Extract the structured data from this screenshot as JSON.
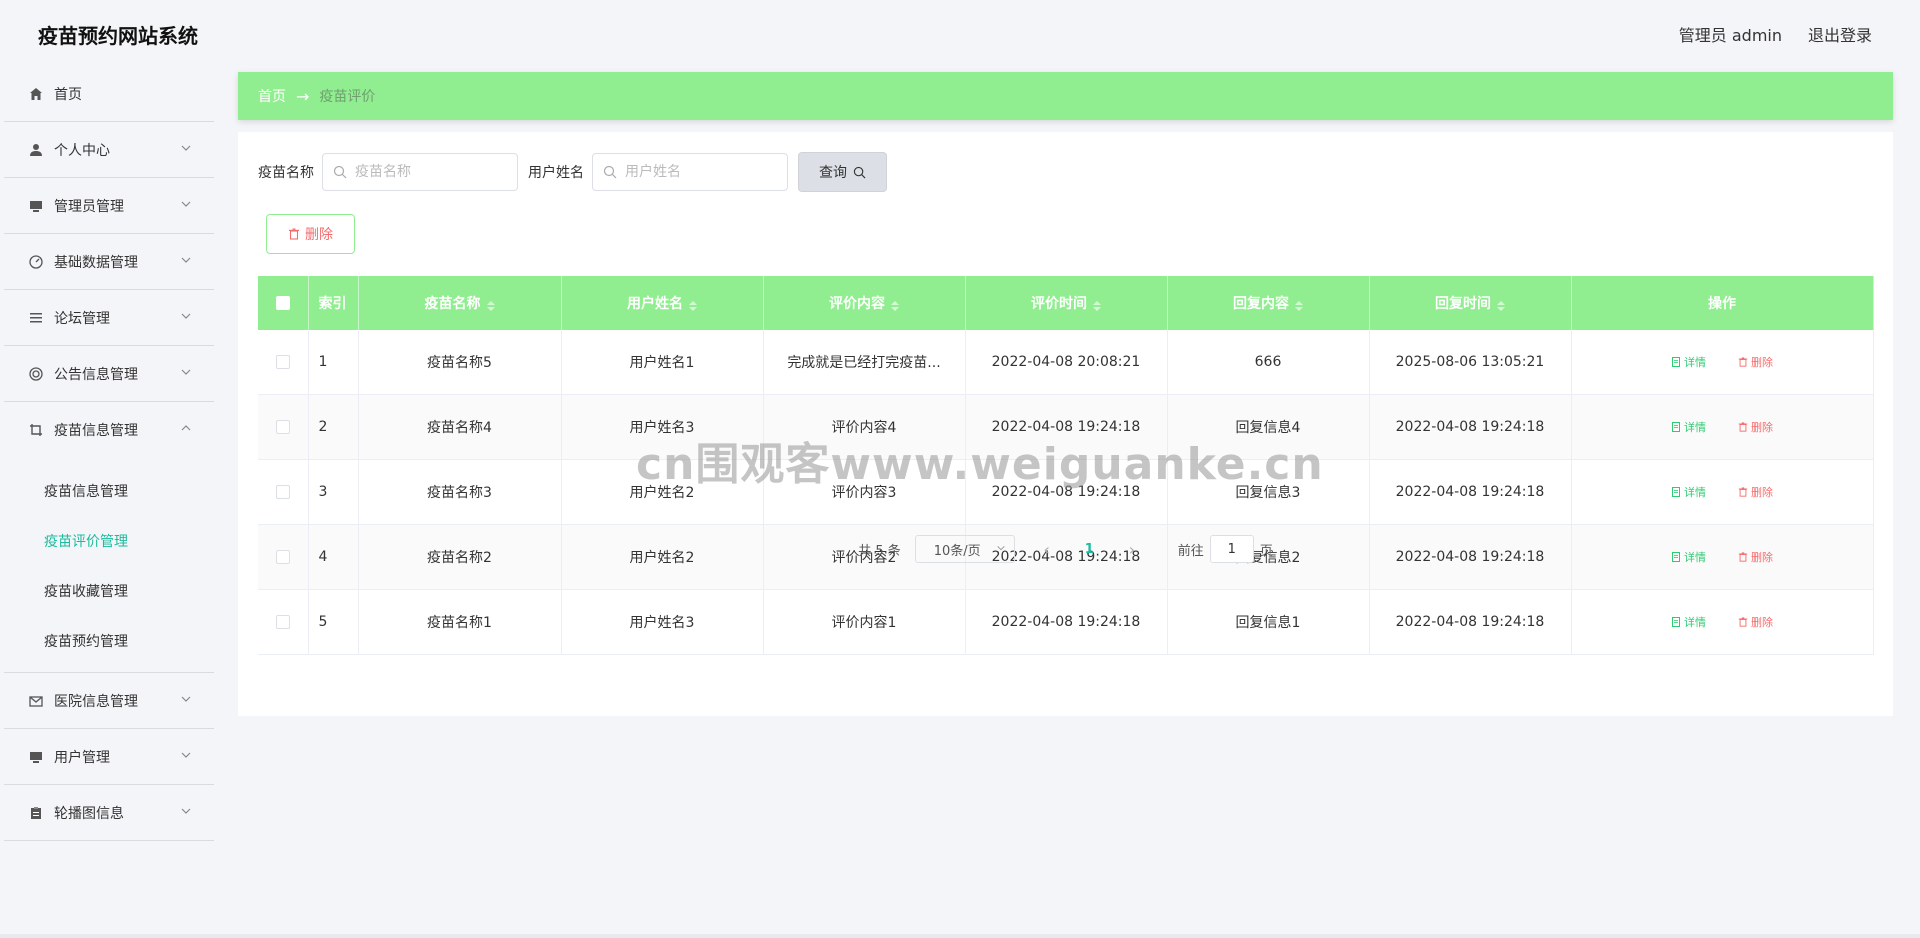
{
  "header": {
    "app_title": "疫苗预约网站系统",
    "user_label": "管理员 admin",
    "logout_label": "退出登录"
  },
  "sidebar": {
    "items": [
      {
        "label": "首页",
        "icon": "home-icon"
      },
      {
        "label": "个人中心",
        "icon": "user-icon"
      },
      {
        "label": "管理员管理",
        "icon": "monitor-icon"
      },
      {
        "label": "基础数据管理",
        "icon": "gauge-icon"
      },
      {
        "label": "论坛管理",
        "icon": "list-icon"
      },
      {
        "label": "公告信息管理",
        "icon": "lifebuoy-icon"
      },
      {
        "label": "疫苗信息管理",
        "icon": "crop-icon"
      },
      {
        "label": "医院信息管理",
        "icon": "mail-icon"
      },
      {
        "label": "用户管理",
        "icon": "monitor-icon"
      },
      {
        "label": "轮播图信息",
        "icon": "clipboard-icon"
      }
    ],
    "submenu": [
      {
        "label": "疫苗信息管理"
      },
      {
        "label": "疫苗评价管理"
      },
      {
        "label": "疫苗收藏管理"
      },
      {
        "label": "疫苗预约管理"
      }
    ]
  },
  "breadcrumb": {
    "home": "首页",
    "arrow": "→",
    "current": "疫苗评价"
  },
  "search": {
    "vaccine_label": "疫苗名称",
    "vaccine_placeholder": "疫苗名称",
    "user_label": "用户姓名",
    "user_placeholder": "用户姓名",
    "query_label": "查询"
  },
  "toolbar": {
    "delete_label": "删除"
  },
  "table": {
    "headers": [
      "索引",
      "疫苗名称",
      "用户姓名",
      "评价内容",
      "评价时间",
      "回复内容",
      "回复时间",
      "操作"
    ],
    "rows": [
      {
        "idx": "1",
        "vaccine": "疫苗名称5",
        "user": "用户姓名1",
        "content": "完成就是已经打完疫苗...",
        "time": "2022-04-08 20:08:21",
        "reply": "666",
        "reply_time": "2025-08-06 13:05:21"
      },
      {
        "idx": "2",
        "vaccine": "疫苗名称4",
        "user": "用户姓名3",
        "content": "评价内容4",
        "time": "2022-04-08 19:24:18",
        "reply": "回复信息4",
        "reply_time": "2022-04-08 19:24:18"
      },
      {
        "idx": "3",
        "vaccine": "疫苗名称3",
        "user": "用户姓名2",
        "content": "评价内容3",
        "time": "2022-04-08 19:24:18",
        "reply": "回复信息3",
        "reply_time": "2022-04-08 19:24:18"
      },
      {
        "idx": "4",
        "vaccine": "疫苗名称2",
        "user": "用户姓名2",
        "content": "评价内容2",
        "time": "2022-04-08 19:24:18",
        "reply": "回复信息2",
        "reply_time": "2022-04-08 19:24:18"
      },
      {
        "idx": "5",
        "vaccine": "疫苗名称1",
        "user": "用户姓名3",
        "content": "评价内容1",
        "time": "2022-04-08 19:24:18",
        "reply": "回复信息1",
        "reply_time": "2022-04-08 19:24:18"
      }
    ],
    "detail_label": "详情",
    "row_delete_label": "删除"
  },
  "pager": {
    "total": "共 5 条",
    "page_size": "10条/页",
    "current_page": "1",
    "goto_label": "前往",
    "goto_value": "1",
    "page_suffix": "页"
  },
  "watermark": "cn围观客www.weiguanke.cn",
  "colors": {
    "accent": "#90ee90",
    "active_menu": "#1abc9c",
    "danger": "#f56c6c"
  }
}
